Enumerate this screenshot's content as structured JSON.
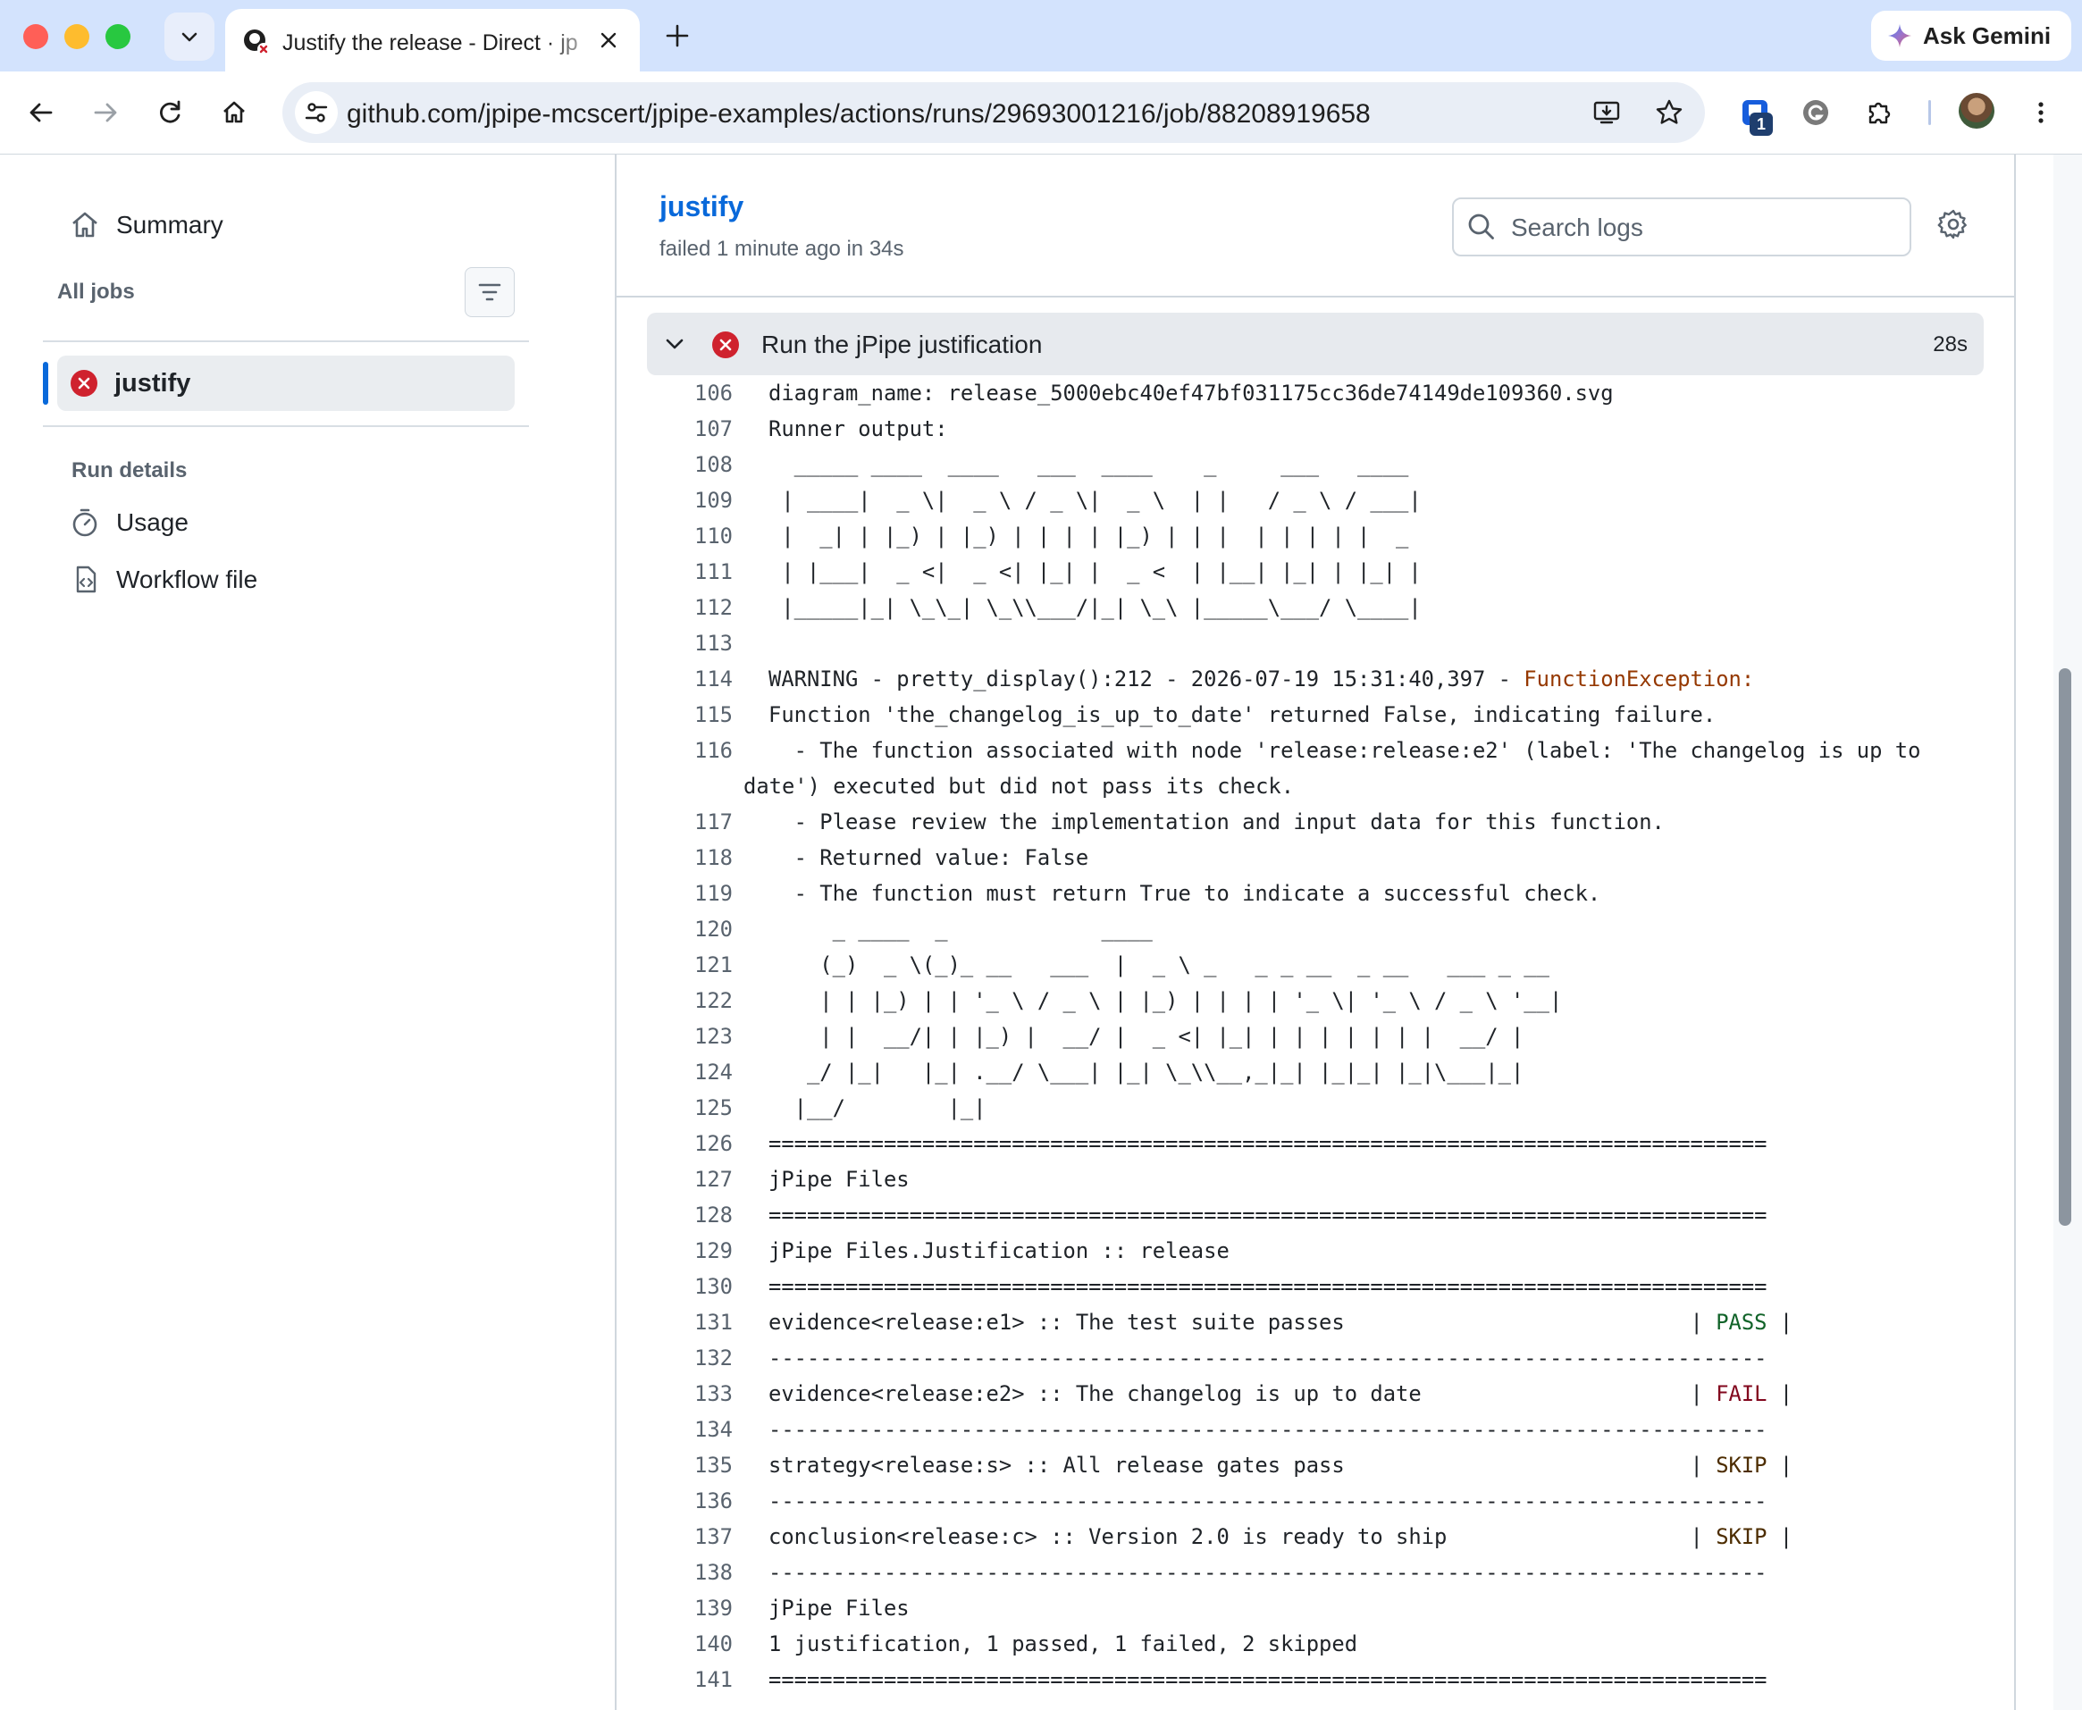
{
  "browser": {
    "tab_title": "Justify the release - Direct · jp",
    "url": "github.com/jpipe-mcscert/jpipe-examples/actions/runs/29693001216/job/88208919658",
    "gemini_label": "Ask Gemini",
    "extension_badge": "1"
  },
  "sidebar": {
    "summary_label": "Summary",
    "all_jobs_label": "All jobs",
    "job_label": "justify",
    "run_details_label": "Run details",
    "usage_label": "Usage",
    "workflow_file_label": "Workflow file"
  },
  "job": {
    "title": "justify",
    "subtitle": "failed 1 minute ago in 34s",
    "search_placeholder": "Search logs"
  },
  "step": {
    "title": "Run the jPipe justification",
    "duration": "28s"
  },
  "log": [
    {
      "n": "106",
      "t": "diagram_name: release_5000ebc40ef47bf031175cc36de74149de109360.svg"
    },
    {
      "n": "107",
      "t": "Runner output:"
    },
    {
      "n": "108",
      "t": "  _____ ____  ____   ___  ____    _     ___   ____"
    },
    {
      "n": "109",
      "t": " | ____|  _ \\|  _ \\ / _ \\|  _ \\  | |   / _ \\ / ___|"
    },
    {
      "n": "110",
      "t": " |  _| | |_) | |_) | | | | |_) | | |  | | | | |  _"
    },
    {
      "n": "111",
      "t": " | |___|  _ <|  _ <| |_| |  _ <  | |__| |_| | |_| |"
    },
    {
      "n": "112",
      "t": " |_____|_| \\_\\_| \\_\\\\___/|_| \\_\\ |_____\\___/ \\____|"
    },
    {
      "n": "113",
      "t": ""
    },
    {
      "n": "114",
      "t": "WARNING - pretty_display():212 - 2026-07-19 15:31:40,397 - ",
      "exc": "FunctionException:"
    },
    {
      "n": "115",
      "t": "Function 'the_changelog_is_up_to_date' returned False, indicating failure."
    },
    {
      "n": "116",
      "t": "  - The function associated with node 'release:release:e2' (label: 'The changelog is up to",
      "t2": "date') executed but did not pass its check."
    },
    {
      "n": "117",
      "t": "  - Please review the implementation and input data for this function."
    },
    {
      "n": "118",
      "t": "  - Returned value: False"
    },
    {
      "n": "119",
      "t": "  - The function must return True to indicate a successful check."
    },
    {
      "n": "120",
      "t": "     _ ____  _            ____"
    },
    {
      "n": "121",
      "t": "    (_)  _ \\(_)_ __   ___  |  _ \\ _   _ _ __  _ __   ___ _ __"
    },
    {
      "n": "122",
      "t": "    | | |_) | | '_ \\ / _ \\ | |_) | | | | '_ \\| '_ \\ / _ \\ '__|"
    },
    {
      "n": "123",
      "t": "    | |  __/| | |_) |  __/ |  _ <| |_| | | | | | | |  __/ |"
    },
    {
      "n": "124",
      "t": "   _/ |_|   |_| .__/ \\___| |_| \\_\\\\__,_|_| |_|_| |_|\\___|_|"
    },
    {
      "n": "125",
      "t": "  |__/        |_|"
    },
    {
      "n": "126",
      "t": "=============================================================================="
    },
    {
      "n": "127",
      "t": "jPipe Files"
    },
    {
      "n": "128",
      "t": "=============================================================================="
    },
    {
      "n": "129",
      "t": "jPipe Files.Justification :: release"
    },
    {
      "n": "130",
      "t": "=============================================================================="
    },
    {
      "n": "131",
      "t": "evidence<release:e1> :: The test suite passes                           | ",
      "status": "PASS",
      "cls": "hl-pass"
    },
    {
      "n": "132",
      "t": "------------------------------------------------------------------------------"
    },
    {
      "n": "133",
      "t": "evidence<release:e2> :: The changelog is up to date                     | ",
      "status": "FAIL",
      "cls": "hl-fail"
    },
    {
      "n": "134",
      "t": "------------------------------------------------------------------------------"
    },
    {
      "n": "135",
      "t": "strategy<release:s> :: All release gates pass                           | ",
      "status": "SKIP",
      "cls": "hl-skip"
    },
    {
      "n": "136",
      "t": "------------------------------------------------------------------------------"
    },
    {
      "n": "137",
      "t": "conclusion<release:c> :: Version 2.0 is ready to ship                   | ",
      "status": "SKIP",
      "cls": "hl-skip"
    },
    {
      "n": "138",
      "t": "------------------------------------------------------------------------------"
    },
    {
      "n": "139",
      "t": "jPipe Files"
    },
    {
      "n": "140",
      "t": "1 justification, 1 passed, 1 failed, 2 skipped"
    },
    {
      "n": "141",
      "t": "=============================================================================="
    }
  ]
}
